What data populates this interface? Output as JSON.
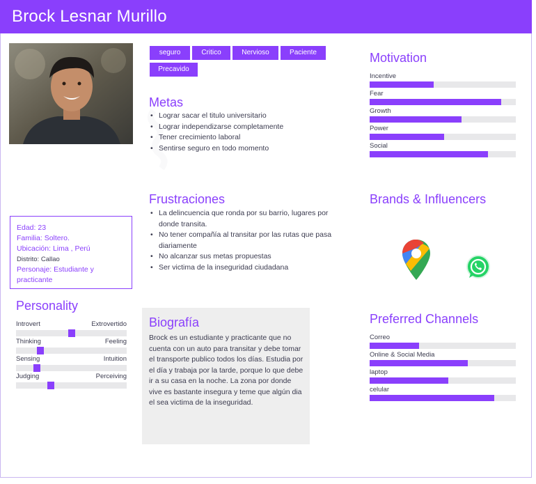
{
  "persona": {
    "name": "Brock Lesnar Murillo"
  },
  "tags": [
    "seguro",
    "Critico",
    "Nervioso",
    "Paciente",
    "Precavido"
  ],
  "goals": {
    "title": "Metas",
    "items": [
      "Lograr sacar el titulo universitario",
      "Lograr independizarse completamente",
      "Tener crecimiento laboral",
      "Sentirse seguro en todo momento"
    ]
  },
  "frustrations": {
    "title": "Frustraciones",
    "items": [
      "La delincuencia que ronda por su barrio, lugares por donde transita.",
      "No tener compañía al transitar por las rutas que pasa diariamente",
      "No alcanzar sus metas propuestas",
      "Ser victima de la inseguridad ciudadana"
    ]
  },
  "info": {
    "age_label": "Edad:",
    "age": "23",
    "family_label": "Familia:",
    "family": "Soltero.",
    "location_label": "Ubicación:",
    "location": "Lima , Perú",
    "district": "Distrito: Callao",
    "character_label": "Personaje:",
    "character": "Estudiante y practicante"
  },
  "personality": {
    "title": "Personality",
    "traits": [
      {
        "left": "Introvert",
        "right": "Extrovertido",
        "value": 0.5
      },
      {
        "left": "Thinking",
        "right": "Feeling",
        "value": 0.2
      },
      {
        "left": "Sensing",
        "right": "Intuition",
        "value": 0.17
      },
      {
        "left": "Judging",
        "right": "Perceiving",
        "value": 0.3
      }
    ]
  },
  "bio": {
    "title": "Biografía",
    "text": "Brock es un estudiante y practicante que no cuenta con un auto para transitar  y debe tomar el transporte publico todos los días. Estudia por el día y trabaja por la tarde, porque lo que debe ir a su casa en la noche. La zona por donde vive es bastante insegura y teme que algún dia el sea victima de la inseguridad."
  },
  "motivation": {
    "title": "Motivation",
    "items": [
      {
        "label": "Incentive",
        "value": 0.44
      },
      {
        "label": "Fear",
        "value": 0.9
      },
      {
        "label": "Growth",
        "value": 0.63
      },
      {
        "label": "Power",
        "value": 0.51
      },
      {
        "label": "Social",
        "value": 0.81
      }
    ]
  },
  "brands": {
    "title": "Brands & Influencers",
    "logos": [
      "google-maps-icon",
      "whatsapp-icon"
    ]
  },
  "channels": {
    "title": "Preferred Channels",
    "items": [
      {
        "label": "Correo",
        "value": 0.34
      },
      {
        "label": "Online & Social Media",
        "value": 0.67
      },
      {
        "label": "laptop",
        "value": 0.54
      },
      {
        "label": "celular",
        "value": 0.85
      }
    ]
  },
  "colors": {
    "accent": "#8a3ffc",
    "track": "#e8e8ea",
    "bio_bg": "#eeeeee"
  }
}
